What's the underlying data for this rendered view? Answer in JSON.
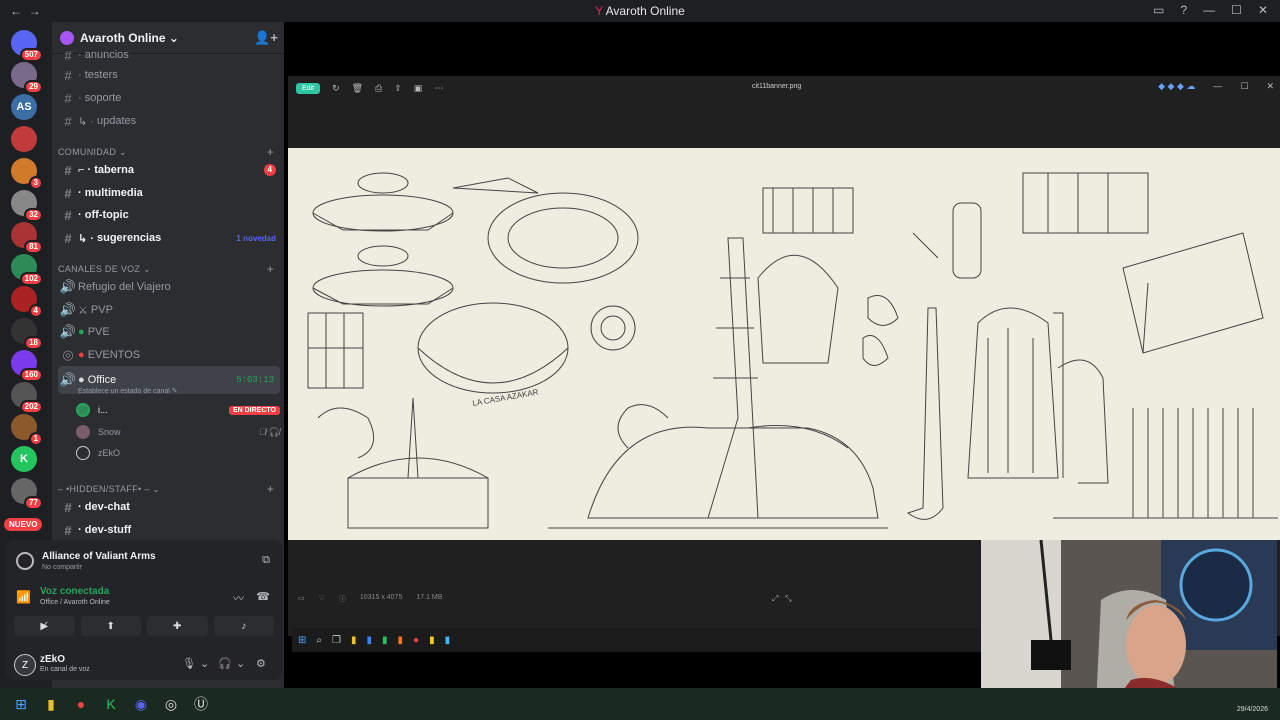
{
  "window": {
    "title": "Avaroth Online",
    "icon": "avaroth-logo-icon"
  },
  "servers": [
    {
      "badge": "507",
      "color": "#5865f2"
    },
    {
      "badge": "29",
      "color": "#7a6a8a"
    },
    {
      "badge": "",
      "color": "#3a6ea5",
      "label": "AS"
    },
    {
      "badge": "",
      "color": "#c23b3b"
    },
    {
      "badge": "3",
      "color": "#d07a2a"
    },
    {
      "badge": "32",
      "color": "#888888"
    },
    {
      "badge": "81",
      "color": "#aa3333"
    },
    {
      "badge": "102",
      "color": "#2e8b57"
    },
    {
      "badge": "4",
      "color": "#aa2222"
    },
    {
      "badge": "18",
      "color": "#333333"
    },
    {
      "badge": "160",
      "color": "#7c3aed"
    },
    {
      "badge": "202",
      "color": "#555555"
    },
    {
      "badge": "1",
      "color": "#8b5a2b"
    },
    {
      "badge": "",
      "color": "#22c55e",
      "label": "K"
    },
    {
      "badge": "77",
      "color": "#666666"
    }
  ],
  "nuevo_label": "NUEVO",
  "guild": {
    "name": "Avaroth Online"
  },
  "channels": {
    "top": [
      {
        "name": "anuncios",
        "prefix": "·"
      },
      {
        "name": "testers",
        "prefix": "·"
      },
      {
        "name": "soporte",
        "prefix": "·"
      },
      {
        "name": "updates",
        "prefix": "↳ ·"
      }
    ],
    "comunidad_label": "COMUNIDAD",
    "comunidad": [
      {
        "name": "taberna",
        "badge": "4"
      },
      {
        "name": "multimedia"
      },
      {
        "name": "off-topic"
      },
      {
        "name": "sugerencias",
        "note": "1 novedad"
      }
    ],
    "voz_label": "CANALES DE VOZ",
    "voz": [
      {
        "name": "Refugio del Viajero"
      },
      {
        "name": "PVP"
      },
      {
        "name": "PVE"
      },
      {
        "name": "EVENTOS"
      }
    ],
    "office": {
      "name": "Office",
      "status": "Establece un estado de canal",
      "timer": "5:03:13"
    },
    "voice_users": [
      {
        "name": "i...",
        "live": "EN DIRECTO"
      },
      {
        "name": "Snow"
      },
      {
        "name": "zEkO"
      }
    ],
    "hidden_label": "– •HIDDEN/STAFF• –",
    "hidden": [
      {
        "name": "dev-chat"
      },
      {
        "name": "dev-stuff"
      }
    ]
  },
  "activity": {
    "title": "Alliance of Valiant Arms",
    "subtitle": "No compartir"
  },
  "voice": {
    "title": "Voz conectada",
    "subtitle": "Office / Avaroth Online"
  },
  "user": {
    "name": "zEkO",
    "status": "En canal de voz"
  },
  "viewer": {
    "edit_label": "Edit",
    "filename": "cit11banner.png",
    "dimensions": "10315 x 4075",
    "size": "17.1 MB"
  },
  "sketch_text": "LA CASA AZAKAR",
  "clock": "29/4/2026"
}
